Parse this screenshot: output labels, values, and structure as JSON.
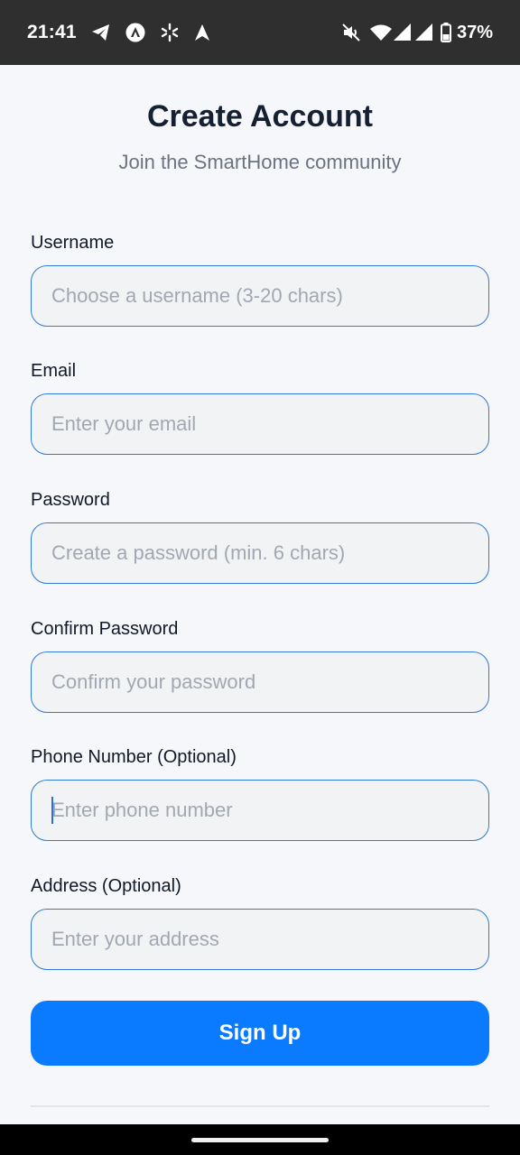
{
  "status_bar": {
    "time": "21:41",
    "left_icons": [
      "telegram-icon",
      "app-a-icon",
      "pinwheel-icon",
      "arrow-nav-icon"
    ],
    "right_icons": [
      "mute-icon",
      "wifi-icon",
      "signal-icon",
      "signal-icon",
      "battery-icon"
    ],
    "battery_percent": "37%"
  },
  "header": {
    "title": "Create Account",
    "subtitle": "Join the SmartHome community"
  },
  "form": {
    "fields": [
      {
        "label": "Username",
        "placeholder": "Choose a username (3-20 chars)",
        "value": ""
      },
      {
        "label": "Email",
        "placeholder": "Enter your email",
        "value": ""
      },
      {
        "label": "Password",
        "placeholder": "Create a password (min. 6 chars)",
        "value": ""
      },
      {
        "label": "Confirm Password",
        "placeholder": "Confirm your password",
        "value": ""
      },
      {
        "label": "Phone Number (Optional)",
        "placeholder": "Enter phone number",
        "value": ""
      },
      {
        "label": "Address (Optional)",
        "placeholder": "Enter your address",
        "value": ""
      }
    ],
    "submit_label": "Sign Up"
  },
  "colors": {
    "accent": "#0a7bff",
    "input_border": "#2f7ad6",
    "input_bg": "#f2f3f5",
    "page_bg": "#f5f7fa",
    "status_bar_bg": "#2f2f2f"
  }
}
